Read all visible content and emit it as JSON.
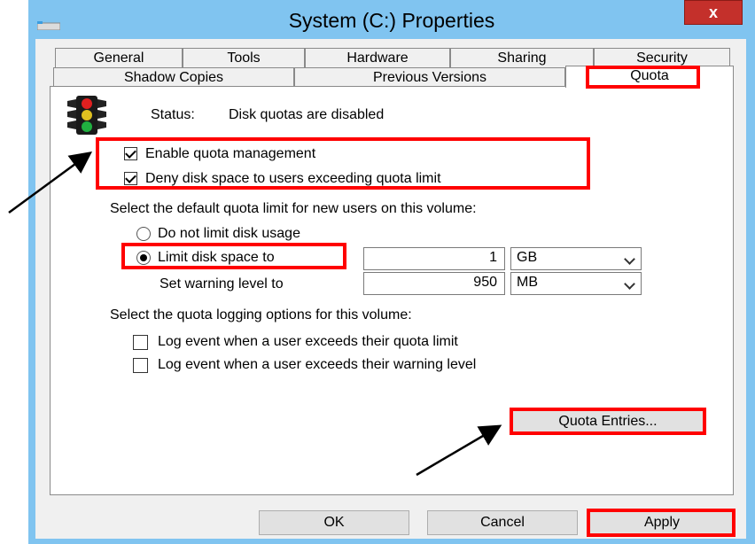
{
  "window": {
    "title": "System (C:) Properties",
    "close_glyph": "x"
  },
  "tabs_row1": [
    "General",
    "Tools",
    "Hardware",
    "Sharing",
    "Security"
  ],
  "tabs_row2": [
    "Shadow Copies",
    "Previous Versions",
    "Quota"
  ],
  "active_tab": "Quota",
  "status": {
    "label": "Status:",
    "value": "Disk quotas are disabled",
    "icon": "traffic-light-icon"
  },
  "options": {
    "enable_quota": {
      "label": "Enable quota management",
      "checked": true
    },
    "deny_space": {
      "label": "Deny disk space to users exceeding quota limit",
      "checked": true
    }
  },
  "default_limit": {
    "heading": "Select the default quota limit for new users on this volume:",
    "no_limit_label": "Do not limit disk usage",
    "limit_label": "Limit disk space to",
    "limit_value": "1",
    "limit_unit": "GB",
    "warning_label": "Set warning level to",
    "warning_value": "950",
    "warning_unit": "MB"
  },
  "logging": {
    "heading": "Select the quota logging options for this volume:",
    "log_limit_label": "Log event when a user exceeds their quota limit",
    "log_warning_label": "Log event when a user exceeds their warning level"
  },
  "buttons": {
    "quota_entries": "Quota Entries...",
    "ok": "OK",
    "cancel": "Cancel",
    "apply": "Apply"
  },
  "colors": {
    "title_bar": "#80c4f0",
    "close": "#c4302b",
    "highlight": "#ff0000"
  }
}
